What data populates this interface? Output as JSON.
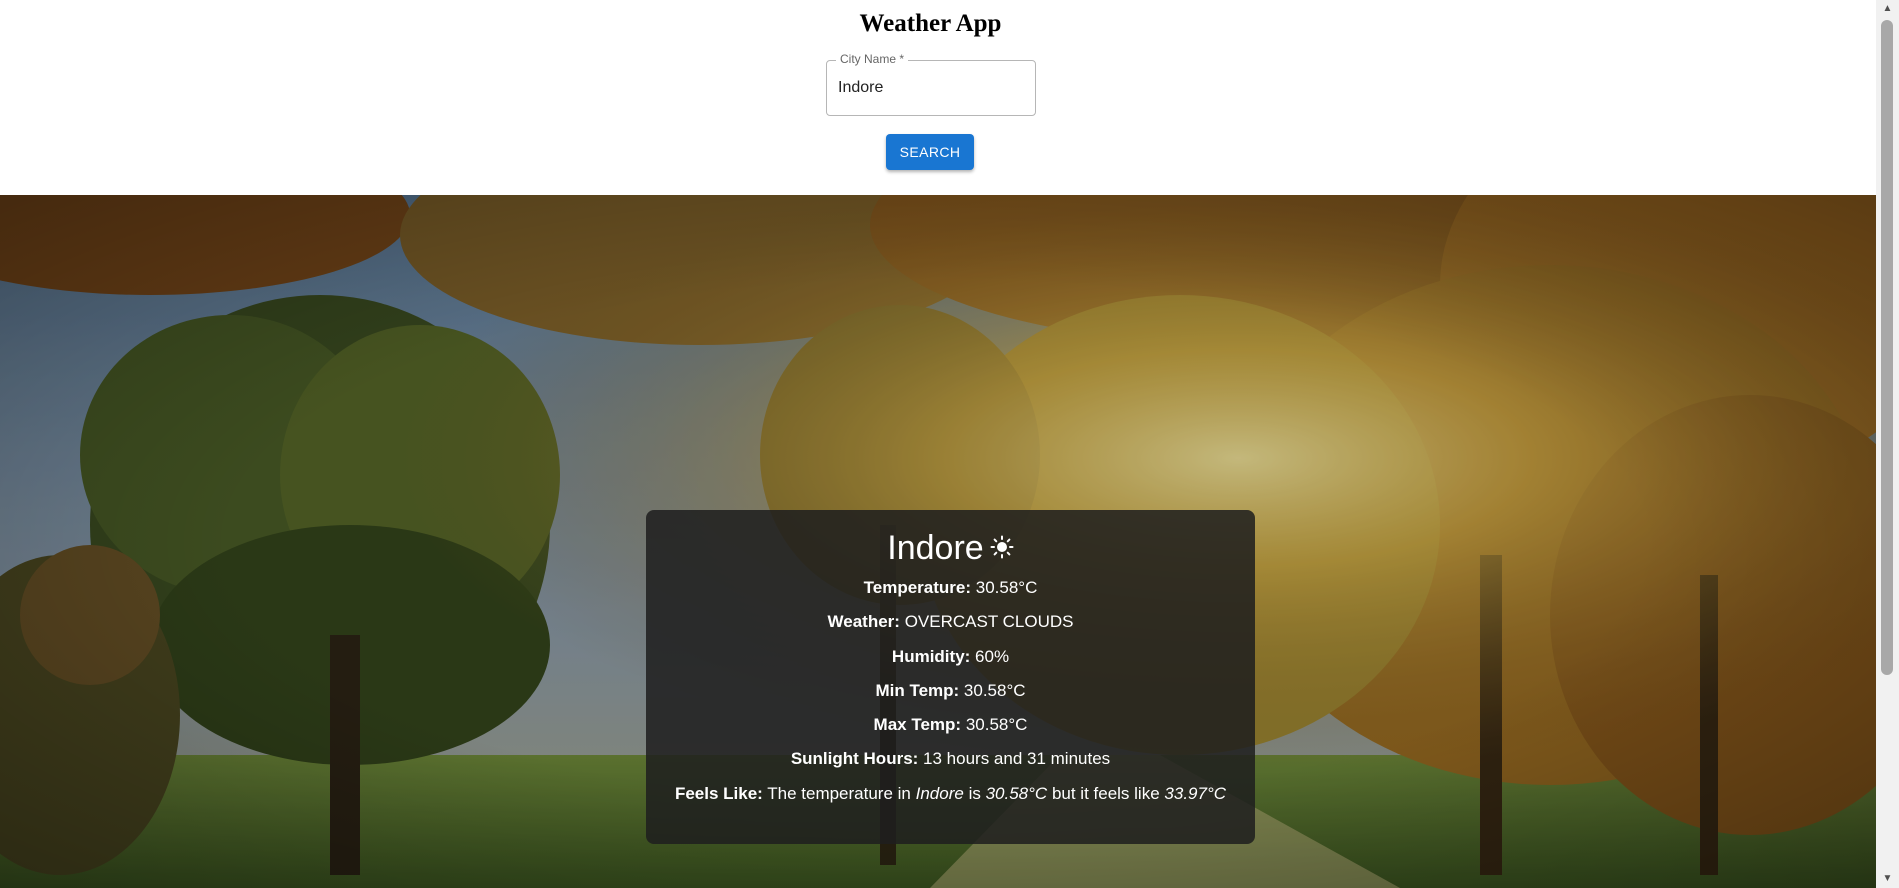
{
  "header": {
    "title": "Weather App",
    "city_field": {
      "label": "City Name *",
      "value": "Indore"
    },
    "search_label": "SEARCH"
  },
  "background": {
    "description_icon": "autumn-park-image"
  },
  "card": {
    "city": "Indore",
    "weather_icon": "sun-icon",
    "rows": {
      "temperature": {
        "label": "Temperature:",
        "value": "30.58°C"
      },
      "weather": {
        "label": "Weather:",
        "value": "OVERCAST CLOUDS"
      },
      "humidity": {
        "label": "Humidity:",
        "value": "60%"
      },
      "min_temp": {
        "label": "Min Temp:",
        "value": "30.58°C"
      },
      "max_temp": {
        "label": "Max Temp:",
        "value": "30.58°C"
      },
      "sunlight": {
        "label": "Sunlight Hours:",
        "value": "13 hours and 31 minutes"
      },
      "feels_like": {
        "label": "Feels Like:",
        "text_1": "The temperature in",
        "city": "Indore",
        "text_2": "is",
        "temp": "30.58°C",
        "text_3": "but it feels like",
        "feels": "33.97°C"
      }
    }
  },
  "colors": {
    "primary": "#1976d2",
    "card_bg": "#1e1e1e"
  }
}
